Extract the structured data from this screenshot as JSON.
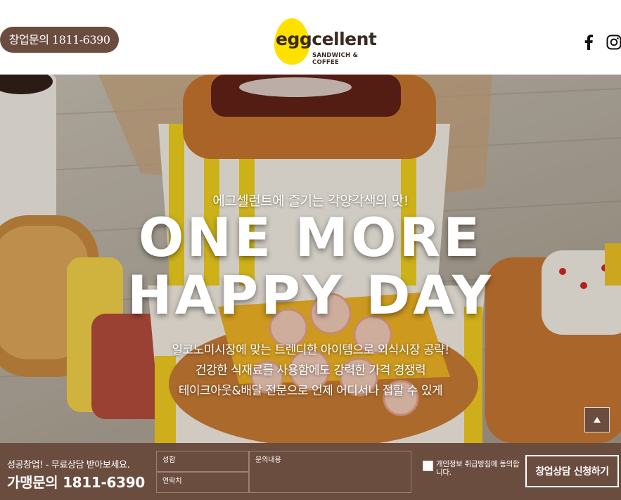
{
  "header": {
    "inquiry_pill": "창업문의 1811-6390",
    "logo_word": "eggcellent",
    "logo_sub": "SANDWICH & COFFEE",
    "social": [
      {
        "icon": "facebook-icon"
      },
      {
        "icon": "instagram-icon"
      }
    ]
  },
  "hero": {
    "kicker": "에그셀런트에 즐기는 각양각색의 맛!",
    "title_line1": "ONE MORE",
    "title_line2": "HAPPY DAY",
    "lines": [
      "일코노미시장에 맞는 트렌디한 아이템으로 외식시장 공략!",
      "건강한 식재료를 사용함에도 강력한 가격 경쟁력",
      "테이크아웃&배달 전문으로 언제 어디서나 접할 수 있게"
    ],
    "scroll_top_icon": "arrow-up-icon"
  },
  "bottom_bar": {
    "subtitle": "성공창업! - 무료상담 받아보세요.",
    "phone": "가맹문의 1811-6390",
    "name_placeholder": "성함",
    "contact_placeholder": "연락치",
    "message_placeholder": "문의내용",
    "consent": "개인정보 취급방침에 동의합니다.",
    "submit": "창업상담 신청하기"
  },
  "colors": {
    "brand_brown": "#6b4d3f",
    "logo_yellow": "#ffe100"
  }
}
